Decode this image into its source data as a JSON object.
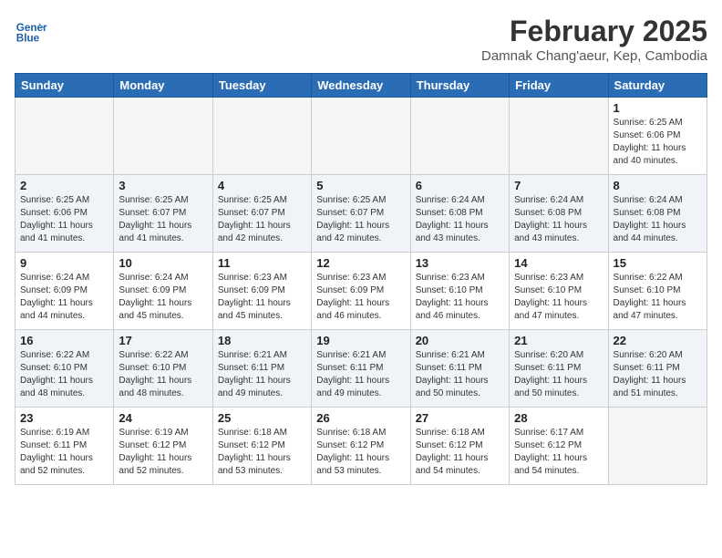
{
  "header": {
    "logo_line1": "General",
    "logo_line2": "Blue",
    "month": "February 2025",
    "location": "Damnak Chang'aeur, Kep, Cambodia"
  },
  "weekdays": [
    "Sunday",
    "Monday",
    "Tuesday",
    "Wednesday",
    "Thursday",
    "Friday",
    "Saturday"
  ],
  "weeks": [
    [
      {
        "day": "",
        "sunrise": "",
        "sunset": "",
        "daylight": ""
      },
      {
        "day": "",
        "sunrise": "",
        "sunset": "",
        "daylight": ""
      },
      {
        "day": "",
        "sunrise": "",
        "sunset": "",
        "daylight": ""
      },
      {
        "day": "",
        "sunrise": "",
        "sunset": "",
        "daylight": ""
      },
      {
        "day": "",
        "sunrise": "",
        "sunset": "",
        "daylight": ""
      },
      {
        "day": "",
        "sunrise": "",
        "sunset": "",
        "daylight": ""
      },
      {
        "day": "1",
        "sunrise": "Sunrise: 6:25 AM",
        "sunset": "Sunset: 6:06 PM",
        "daylight": "Daylight: 11 hours and 40 minutes."
      }
    ],
    [
      {
        "day": "2",
        "sunrise": "Sunrise: 6:25 AM",
        "sunset": "Sunset: 6:06 PM",
        "daylight": "Daylight: 11 hours and 41 minutes."
      },
      {
        "day": "3",
        "sunrise": "Sunrise: 6:25 AM",
        "sunset": "Sunset: 6:07 PM",
        "daylight": "Daylight: 11 hours and 41 minutes."
      },
      {
        "day": "4",
        "sunrise": "Sunrise: 6:25 AM",
        "sunset": "Sunset: 6:07 PM",
        "daylight": "Daylight: 11 hours and 42 minutes."
      },
      {
        "day": "5",
        "sunrise": "Sunrise: 6:25 AM",
        "sunset": "Sunset: 6:07 PM",
        "daylight": "Daylight: 11 hours and 42 minutes."
      },
      {
        "day": "6",
        "sunrise": "Sunrise: 6:24 AM",
        "sunset": "Sunset: 6:08 PM",
        "daylight": "Daylight: 11 hours and 43 minutes."
      },
      {
        "day": "7",
        "sunrise": "Sunrise: 6:24 AM",
        "sunset": "Sunset: 6:08 PM",
        "daylight": "Daylight: 11 hours and 43 minutes."
      },
      {
        "day": "8",
        "sunrise": "Sunrise: 6:24 AM",
        "sunset": "Sunset: 6:08 PM",
        "daylight": "Daylight: 11 hours and 44 minutes."
      }
    ],
    [
      {
        "day": "9",
        "sunrise": "Sunrise: 6:24 AM",
        "sunset": "Sunset: 6:09 PM",
        "daylight": "Daylight: 11 hours and 44 minutes."
      },
      {
        "day": "10",
        "sunrise": "Sunrise: 6:24 AM",
        "sunset": "Sunset: 6:09 PM",
        "daylight": "Daylight: 11 hours and 45 minutes."
      },
      {
        "day": "11",
        "sunrise": "Sunrise: 6:23 AM",
        "sunset": "Sunset: 6:09 PM",
        "daylight": "Daylight: 11 hours and 45 minutes."
      },
      {
        "day": "12",
        "sunrise": "Sunrise: 6:23 AM",
        "sunset": "Sunset: 6:09 PM",
        "daylight": "Daylight: 11 hours and 46 minutes."
      },
      {
        "day": "13",
        "sunrise": "Sunrise: 6:23 AM",
        "sunset": "Sunset: 6:10 PM",
        "daylight": "Daylight: 11 hours and 46 minutes."
      },
      {
        "day": "14",
        "sunrise": "Sunrise: 6:23 AM",
        "sunset": "Sunset: 6:10 PM",
        "daylight": "Daylight: 11 hours and 47 minutes."
      },
      {
        "day": "15",
        "sunrise": "Sunrise: 6:22 AM",
        "sunset": "Sunset: 6:10 PM",
        "daylight": "Daylight: 11 hours and 47 minutes."
      }
    ],
    [
      {
        "day": "16",
        "sunrise": "Sunrise: 6:22 AM",
        "sunset": "Sunset: 6:10 PM",
        "daylight": "Daylight: 11 hours and 48 minutes."
      },
      {
        "day": "17",
        "sunrise": "Sunrise: 6:22 AM",
        "sunset": "Sunset: 6:10 PM",
        "daylight": "Daylight: 11 hours and 48 minutes."
      },
      {
        "day": "18",
        "sunrise": "Sunrise: 6:21 AM",
        "sunset": "Sunset: 6:11 PM",
        "daylight": "Daylight: 11 hours and 49 minutes."
      },
      {
        "day": "19",
        "sunrise": "Sunrise: 6:21 AM",
        "sunset": "Sunset: 6:11 PM",
        "daylight": "Daylight: 11 hours and 49 minutes."
      },
      {
        "day": "20",
        "sunrise": "Sunrise: 6:21 AM",
        "sunset": "Sunset: 6:11 PM",
        "daylight": "Daylight: 11 hours and 50 minutes."
      },
      {
        "day": "21",
        "sunrise": "Sunrise: 6:20 AM",
        "sunset": "Sunset: 6:11 PM",
        "daylight": "Daylight: 11 hours and 50 minutes."
      },
      {
        "day": "22",
        "sunrise": "Sunrise: 6:20 AM",
        "sunset": "Sunset: 6:11 PM",
        "daylight": "Daylight: 11 hours and 51 minutes."
      }
    ],
    [
      {
        "day": "23",
        "sunrise": "Sunrise: 6:19 AM",
        "sunset": "Sunset: 6:11 PM",
        "daylight": "Daylight: 11 hours and 52 minutes."
      },
      {
        "day": "24",
        "sunrise": "Sunrise: 6:19 AM",
        "sunset": "Sunset: 6:12 PM",
        "daylight": "Daylight: 11 hours and 52 minutes."
      },
      {
        "day": "25",
        "sunrise": "Sunrise: 6:18 AM",
        "sunset": "Sunset: 6:12 PM",
        "daylight": "Daylight: 11 hours and 53 minutes."
      },
      {
        "day": "26",
        "sunrise": "Sunrise: 6:18 AM",
        "sunset": "Sunset: 6:12 PM",
        "daylight": "Daylight: 11 hours and 53 minutes."
      },
      {
        "day": "27",
        "sunrise": "Sunrise: 6:18 AM",
        "sunset": "Sunset: 6:12 PM",
        "daylight": "Daylight: 11 hours and 54 minutes."
      },
      {
        "day": "28",
        "sunrise": "Sunrise: 6:17 AM",
        "sunset": "Sunset: 6:12 PM",
        "daylight": "Daylight: 11 hours and 54 minutes."
      },
      {
        "day": "",
        "sunrise": "",
        "sunset": "",
        "daylight": ""
      }
    ]
  ]
}
